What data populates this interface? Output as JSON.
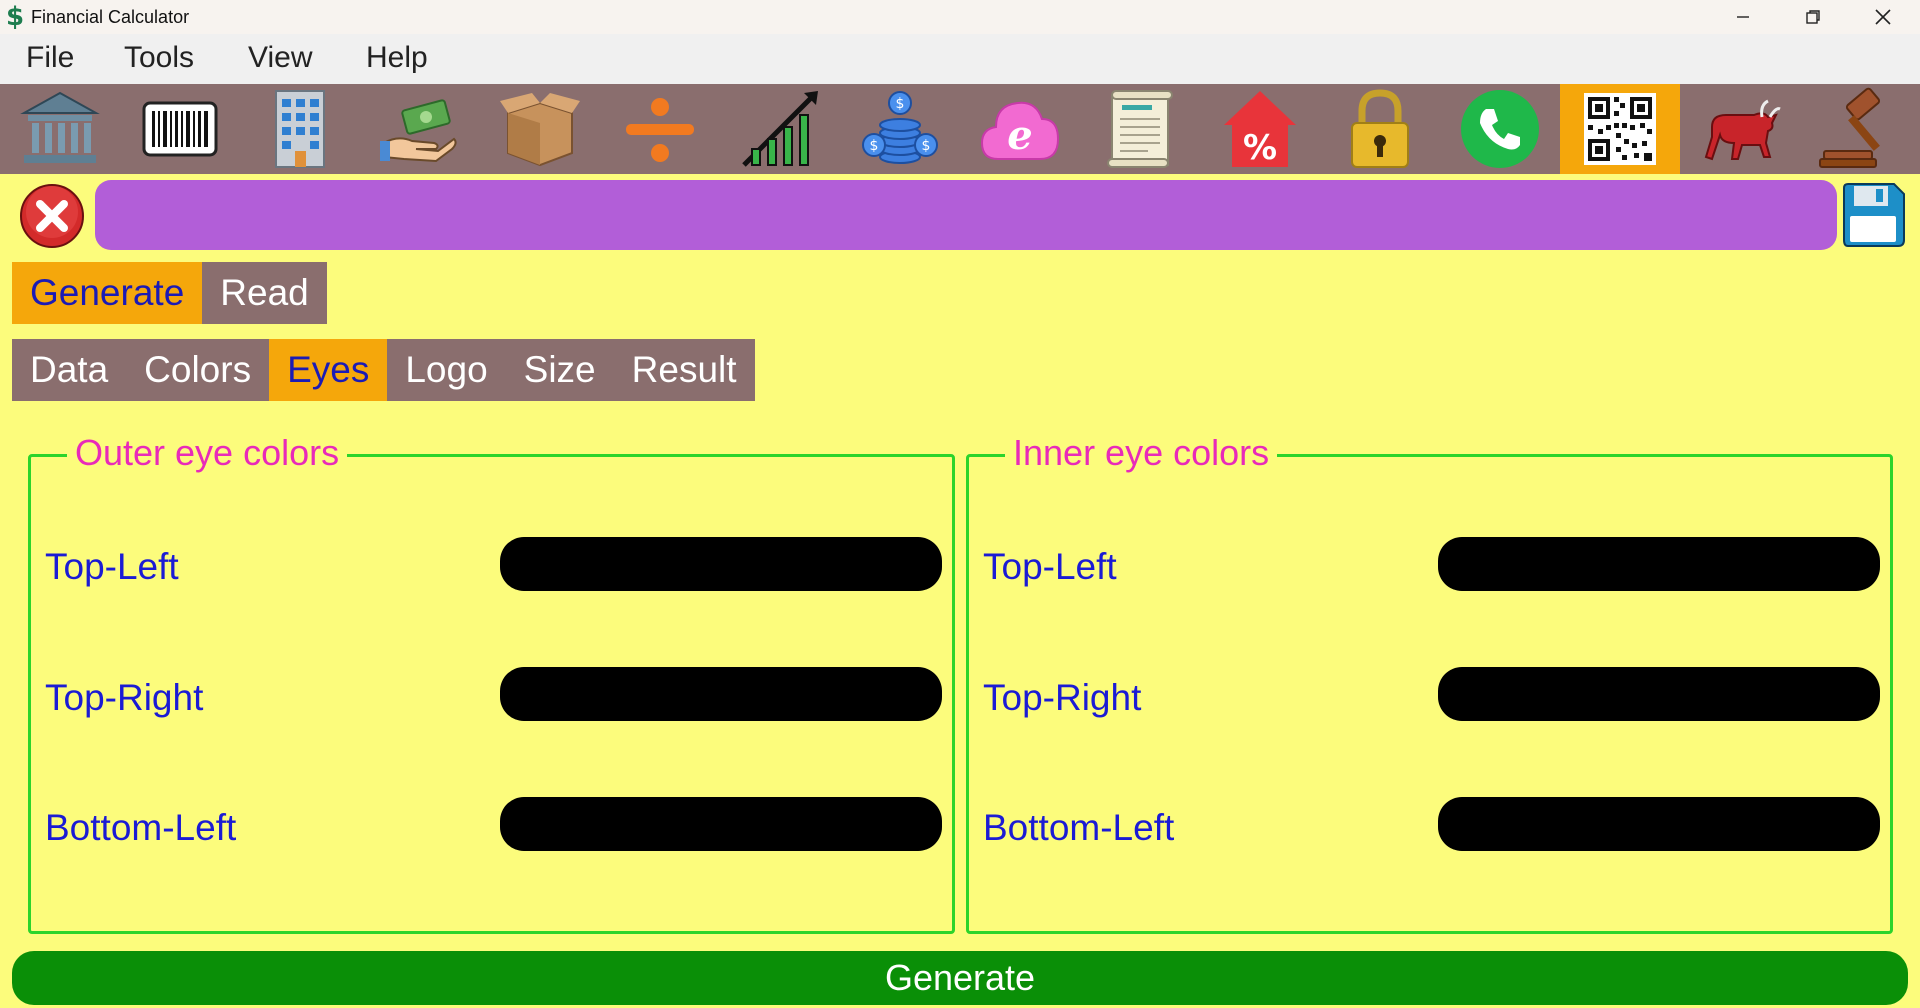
{
  "window": {
    "title": "Financial Calculator",
    "app_icon": "dollar-icon",
    "controls": [
      "minimize-icon",
      "restore-icon",
      "close-icon"
    ]
  },
  "menu": {
    "items": [
      "File",
      "Tools",
      "View",
      "Help"
    ]
  },
  "toolbar": {
    "active_index": 13,
    "tools": [
      "bank-icon",
      "barcode-icon",
      "building-icon",
      "money-hand-icon",
      "box-icon",
      "divide-icon",
      "growth-chart-icon",
      "coins-icon",
      "cloud-browser-icon",
      "scroll-icon",
      "percent-house-icon",
      "padlock-icon",
      "phone-icon",
      "qr-code-icon",
      "bull-icon",
      "gavel-icon"
    ]
  },
  "title_field": {
    "value": "",
    "placeholder": ""
  },
  "tabs_main": {
    "items": [
      "Generate",
      "Read"
    ],
    "active": "Generate"
  },
  "tabs_sub": {
    "items": [
      "Data",
      "Colors",
      "Eyes",
      "Logo",
      "Size",
      "Result"
    ],
    "active": "Eyes"
  },
  "outer_eye": {
    "legend": "Outer eye colors",
    "rows": [
      {
        "label": "Top-Left",
        "color": "#000000"
      },
      {
        "label": "Top-Right",
        "color": "#000000"
      },
      {
        "label": "Bottom-Left",
        "color": "#000000"
      }
    ]
  },
  "inner_eye": {
    "legend": "Inner eye colors",
    "rows": [
      {
        "label": "Top-Left",
        "color": "#000000"
      },
      {
        "label": "Top-Right",
        "color": "#000000"
      },
      {
        "label": "Bottom-Left",
        "color": "#000000"
      }
    ]
  },
  "generate_button": {
    "label": "Generate"
  },
  "colors": {
    "background": "#fcfc7c",
    "toolbar": "#8a6e6e",
    "active_tab": "#f5a70b",
    "title_field": "#b25ed8",
    "group_border": "#2bd42b",
    "legend_text": "#e82ab9",
    "label_text": "#1b1bd4",
    "generate_button": "#0a8f07"
  }
}
